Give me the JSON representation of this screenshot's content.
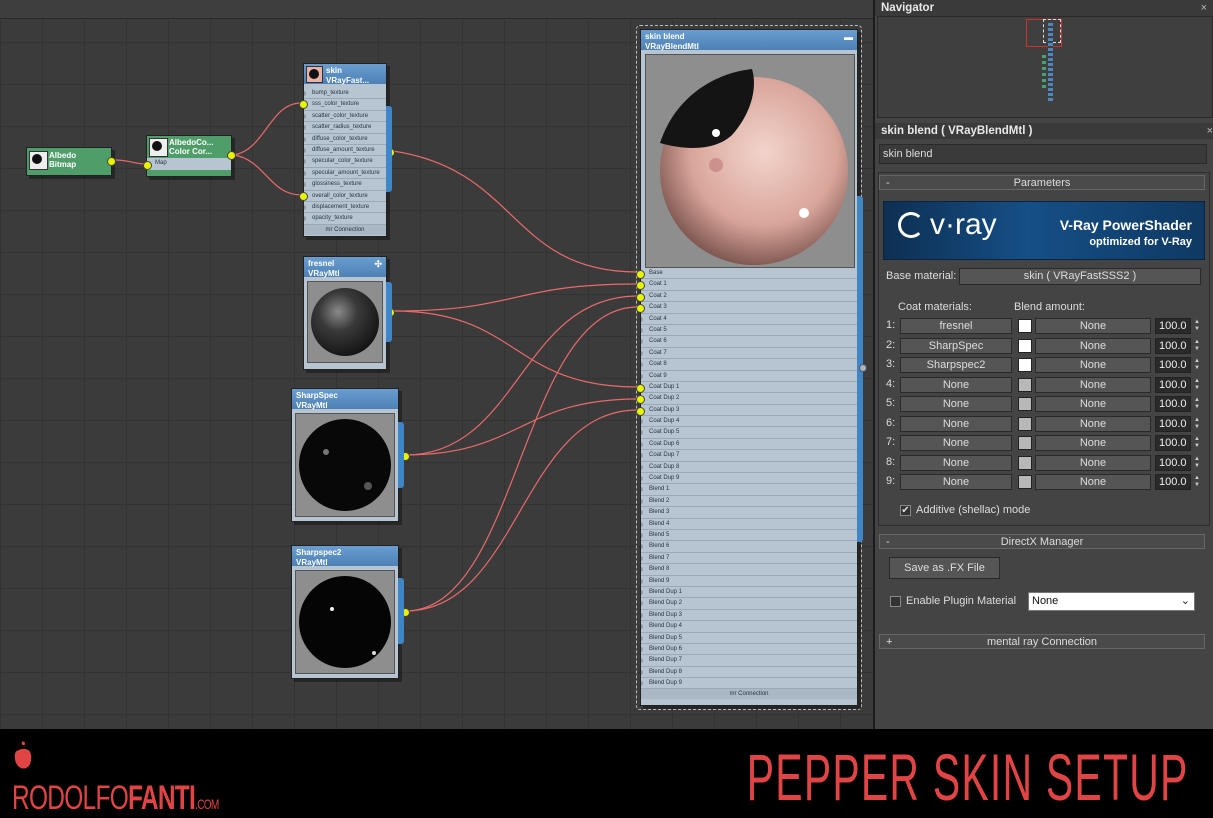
{
  "nodes": {
    "albedo": {
      "title": "Albedo",
      "subtitle": "Bitmap"
    },
    "albedo_cc": {
      "title": "AlbedoCo...",
      "subtitle": "Color Cor...",
      "slot": "Map"
    },
    "skin": {
      "title": "skin",
      "subtitle": "VRayFast...",
      "slots": [
        "bump_texture",
        "sss_color_texture",
        "scatter_color_texture",
        "scatter_radius_texture",
        "diffuse_color_texture",
        "diffuse_amount_texture",
        "specular_color_texture",
        "specular_amount_texture",
        "glossiness_texture",
        "overall_color_texture",
        "displacement_texture",
        "opacity_texture"
      ],
      "footer": "mr Connection"
    },
    "fresnel": {
      "title": "fresnel",
      "subtitle": "VRayMtl"
    },
    "sharpspec": {
      "title": "SharpSpec",
      "subtitle": "VRayMtl"
    },
    "sharpspec2": {
      "title": "Sharpspec2",
      "subtitle": "VRayMtl"
    },
    "blend": {
      "title": "skin blend",
      "subtitle": "VRayBlendMtl",
      "slots": [
        "Base",
        "Coat 1",
        "Coat 2",
        "Coat 3",
        "Coat 4",
        "Coat 5",
        "Coat 6",
        "Coat 7",
        "Coat 8",
        "Coat 9",
        "Coat Dup 1",
        "Coat Dup 2",
        "Coat Dup 3",
        "Coat Dup 4",
        "Coat Dup 5",
        "Coat Dup 6",
        "Coat Dup 7",
        "Coat Dup 8",
        "Coat Dup 9",
        "Blend 1",
        "Blend 2",
        "Blend 3",
        "Blend 4",
        "Blend 5",
        "Blend 6",
        "Blend 7",
        "Blend 8",
        "Blend 9",
        "Blend Dup 1",
        "Blend Dup 2",
        "Blend Dup 3",
        "Blend Dup 4",
        "Blend Dup 5",
        "Blend Dup 6",
        "Blend Dup 7",
        "Blend Dup 8",
        "Blend Dup 9"
      ],
      "footer": "mr Connection"
    }
  },
  "navigator": {
    "title": "Navigator",
    "close": "×"
  },
  "material_panel": {
    "title": "skin blend  ( VRayBlendMtl )",
    "close": "×",
    "name_value": "skin blend",
    "parameters": {
      "rollout_label": "Parameters",
      "sign": "-",
      "banner_logo": "v·ray",
      "banner_title": "V-Ray PowerShader",
      "banner_subtitle": "optimized for V-Ray",
      "base_label": "Base material:",
      "base_value": "skin  ( VRayFastSSS2 )",
      "coat_header": "Coat materials:",
      "blend_header": "Blend amount:",
      "coats": [
        {
          "num": "1:",
          "material": "fresnel",
          "blend": "None",
          "amount": "100.0",
          "color": "#ffffff"
        },
        {
          "num": "2:",
          "material": "SharpSpec",
          "blend": "None",
          "amount": "100.0",
          "color": "#ffffff"
        },
        {
          "num": "3:",
          "material": "Sharpspec2",
          "blend": "None",
          "amount": "100.0",
          "color": "#ffffff"
        },
        {
          "num": "4:",
          "material": "None",
          "blend": "None",
          "amount": "100.0",
          "color": "#b8b8b8"
        },
        {
          "num": "5:",
          "material": "None",
          "blend": "None",
          "amount": "100.0",
          "color": "#b8b8b8"
        },
        {
          "num": "6:",
          "material": "None",
          "blend": "None",
          "amount": "100.0",
          "color": "#b8b8b8"
        },
        {
          "num": "7:",
          "material": "None",
          "blend": "None",
          "amount": "100.0",
          "color": "#b8b8b8"
        },
        {
          "num": "8:",
          "material": "None",
          "blend": "None",
          "amount": "100.0",
          "color": "#b8b8b8"
        },
        {
          "num": "9:",
          "material": "None",
          "blend": "None",
          "amount": "100.0",
          "color": "#b8b8b8"
        }
      ],
      "additive_label": "Additive (shellac) mode",
      "additive_checked": "✔"
    },
    "directx": {
      "rollout_label": "DirectX Manager",
      "sign": "-",
      "save_label": "Save as .FX File",
      "enable_label": "Enable Plugin Material",
      "plugin_value": "None"
    },
    "mental_ray": {
      "rollout_label": "mental ray Connection",
      "sign": "+"
    }
  },
  "footer": {
    "brand_part1": "RODOLFO",
    "brand_part2": "FANTI",
    "brand_domain": ".COM",
    "headline": "PEPPER SKIN SETUP"
  },
  "colors": {
    "wire": "#e86a6a",
    "pin": "#e8f500",
    "brand": "#e04444"
  },
  "icons": {
    "collapse": "chevron-icon",
    "expand": "plus-icon"
  }
}
